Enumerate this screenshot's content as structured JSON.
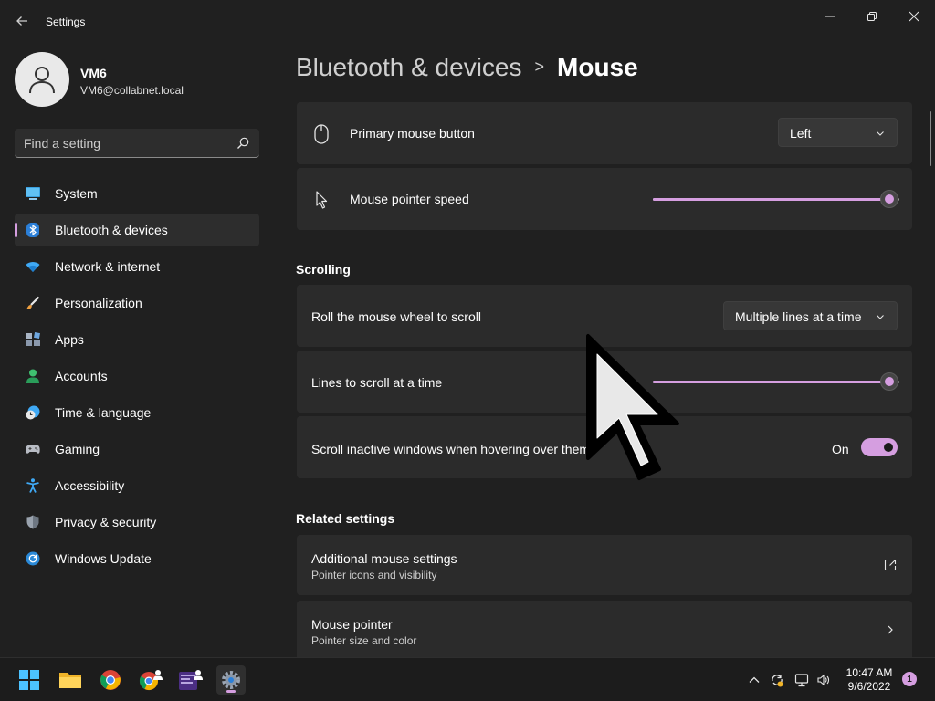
{
  "window": {
    "title": "Settings",
    "controls": {
      "minimize": "minimize",
      "maximize": "maximize",
      "close": "close"
    }
  },
  "profile": {
    "name": "VM6",
    "email": "VM6@collabnet.local"
  },
  "search": {
    "placeholder": "Find a setting"
  },
  "sidebar": {
    "items": [
      {
        "label": "System",
        "icon": "system-icon",
        "active": false
      },
      {
        "label": "Bluetooth & devices",
        "icon": "bluetooth-icon",
        "active": true
      },
      {
        "label": "Network & internet",
        "icon": "wifi-icon",
        "active": false
      },
      {
        "label": "Personalization",
        "icon": "brush-icon",
        "active": false
      },
      {
        "label": "Apps",
        "icon": "apps-icon",
        "active": false
      },
      {
        "label": "Accounts",
        "icon": "person-icon",
        "active": false
      },
      {
        "label": "Time & language",
        "icon": "globe-clock-icon",
        "active": false
      },
      {
        "label": "Gaming",
        "icon": "gamepad-icon",
        "active": false
      },
      {
        "label": "Accessibility",
        "icon": "accessibility-icon",
        "active": false
      },
      {
        "label": "Privacy & security",
        "icon": "shield-icon",
        "active": false
      },
      {
        "label": "Windows Update",
        "icon": "update-icon",
        "active": false
      }
    ]
  },
  "breadcrumb": {
    "parent": "Bluetooth & devices",
    "separator": ">",
    "current": "Mouse"
  },
  "settings": {
    "primary_button": {
      "label": "Primary mouse button",
      "value": "Left"
    },
    "pointer_speed": {
      "label": "Mouse pointer speed",
      "level": 0.96
    },
    "scrolling_title": "Scrolling",
    "roll_wheel": {
      "label": "Roll the mouse wheel to scroll",
      "value": "Multiple lines at a time"
    },
    "lines_to_scroll": {
      "label": "Lines to scroll at a time",
      "level": 0.96
    },
    "scroll_inactive": {
      "label": "Scroll inactive windows when hovering over them",
      "state": "On",
      "on": true
    },
    "related_title": "Related settings",
    "additional": {
      "label": "Additional mouse settings",
      "sub": "Pointer icons and visibility"
    },
    "mouse_pointer": {
      "label": "Mouse pointer",
      "sub": "Pointer size and color"
    }
  },
  "taskbar": {
    "apps": [
      "start-icon",
      "file-explorer-icon",
      "chrome-icon",
      "chrome-profile-icon",
      "terminal-profile-icon",
      "settings-app-icon"
    ],
    "time": "10:47 AM",
    "date": "9/6/2022",
    "notification_count": "1"
  },
  "colors": {
    "accent": "#d59ee0",
    "background": "#202020",
    "card": "#2b2b2b",
    "taskbar": "#1c1c1c"
  }
}
